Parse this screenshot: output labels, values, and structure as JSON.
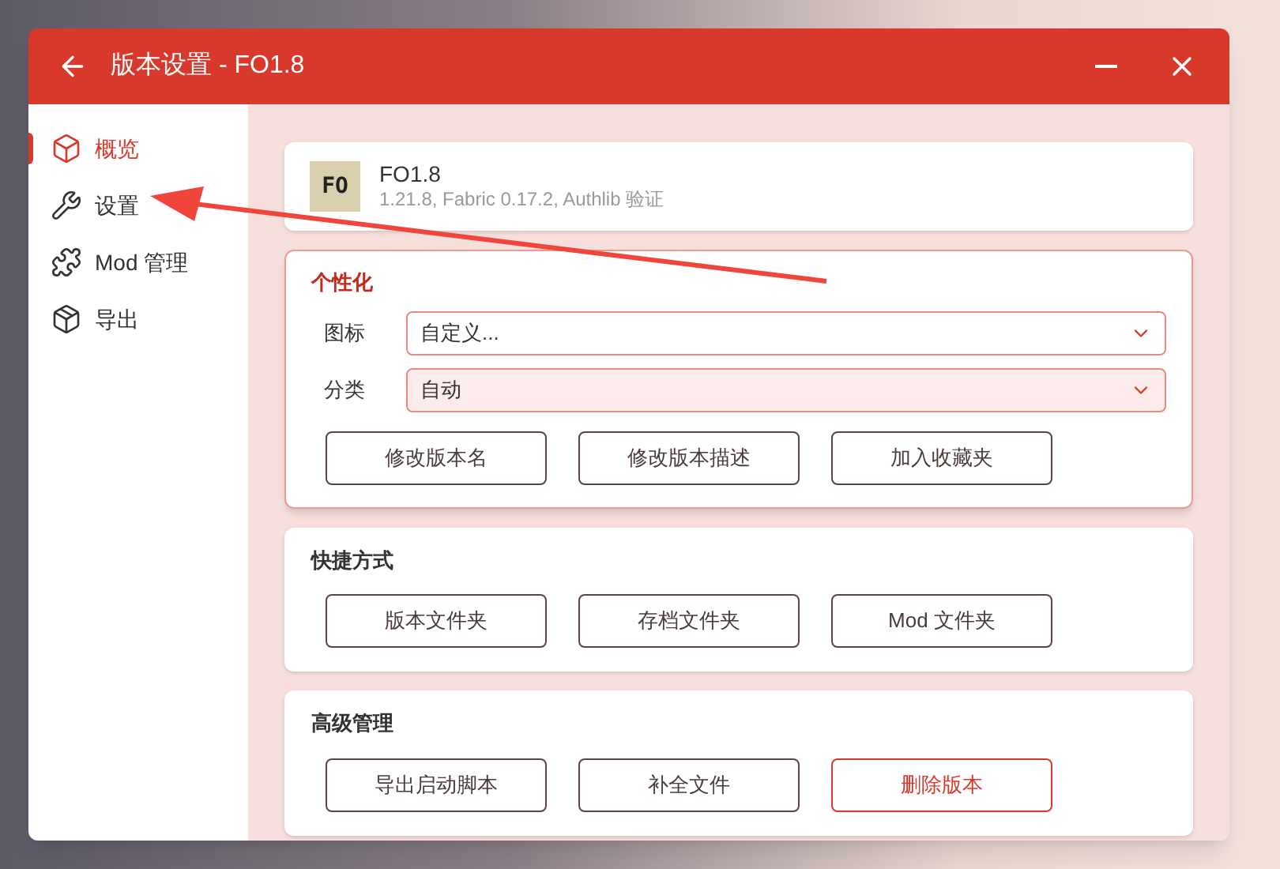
{
  "window": {
    "title": "版本设置 - FO1.8"
  },
  "sidebar": {
    "items": [
      {
        "label": "概览",
        "selected": true,
        "kind": "cube"
      },
      {
        "label": "设置",
        "selected": false,
        "kind": "wrench"
      },
      {
        "label": "Mod 管理",
        "selected": false,
        "kind": "puzzle"
      },
      {
        "label": "导出",
        "selected": false,
        "kind": "package"
      }
    ]
  },
  "version": {
    "icon_text": "FO",
    "name": "FO1.8",
    "details": "1.21.8, Fabric 0.17.2, Authlib 验证"
  },
  "sections": [
    {
      "title": "个性化",
      "highlighted": true,
      "fields": [
        {
          "label": "图标",
          "value": "自定义...",
          "highlighted": false
        },
        {
          "label": "分类",
          "value": "自动",
          "highlighted": true
        }
      ],
      "buttons": [
        {
          "label": "修改版本名",
          "kind": "normal"
        },
        {
          "label": "修改版本描述",
          "kind": "normal"
        },
        {
          "label": "加入收藏夹",
          "kind": "normal"
        }
      ]
    },
    {
      "title": "快捷方式",
      "highlighted": false,
      "buttons": [
        {
          "label": "版本文件夹",
          "kind": "normal"
        },
        {
          "label": "存档文件夹",
          "kind": "normal"
        },
        {
          "label": "Mod 文件夹",
          "kind": "normal"
        }
      ]
    },
    {
      "title": "高级管理",
      "highlighted": false,
      "buttons": [
        {
          "label": "导出启动脚本",
          "kind": "normal"
        },
        {
          "label": "补全文件",
          "kind": "normal"
        },
        {
          "label": "删除版本",
          "kind": "danger"
        }
      ]
    }
  ]
}
